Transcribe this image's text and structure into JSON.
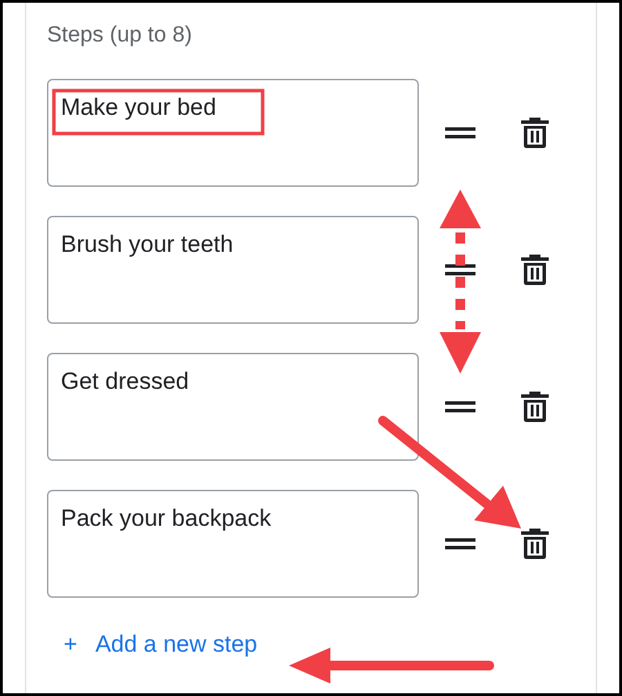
{
  "section_title": "Steps (up to 8)",
  "steps": [
    {
      "value": "Make your bed"
    },
    {
      "value": "Brush your teeth"
    },
    {
      "value": "Get dressed"
    },
    {
      "value": "Pack your backpack"
    }
  ],
  "add_link": {
    "icon": "+",
    "label": "Add a new step"
  }
}
